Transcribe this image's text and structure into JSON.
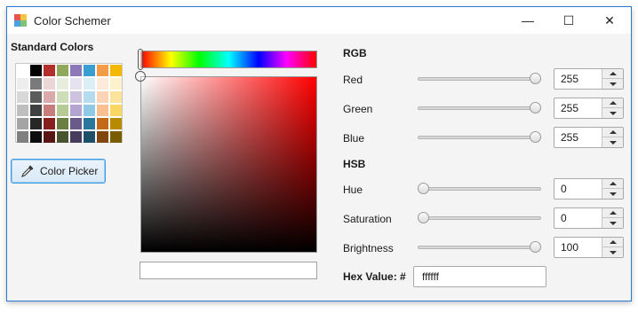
{
  "window": {
    "title": "Color Schemer",
    "controls": {
      "minimize": "—",
      "maximize": "☐",
      "close": "✕"
    }
  },
  "standard_colors": {
    "title": "Standard Colors",
    "rows": [
      [
        "#ffffff",
        "#000000",
        "#b22f2c",
        "#8fa85a",
        "#8e79b8",
        "#3a9ed0",
        "#f39c47",
        "#f5b800"
      ],
      [
        "#ededed",
        "#7a7a7a",
        "#ecd6d5",
        "#e7eddc",
        "#e6e1ef",
        "#dbeef6",
        "#fdeadb",
        "#fdf2cc"
      ],
      [
        "#d8d8d8",
        "#5c5c5c",
        "#d9aaa9",
        "#cfdcb8",
        "#cdc3df",
        "#b5dbee",
        "#fbd4b6",
        "#fbe49a"
      ],
      [
        "#bfbfbf",
        "#404040",
        "#c67d7b",
        "#b6ca94",
        "#b3a5cf",
        "#8fc9e5",
        "#f9bf91",
        "#f9d765"
      ],
      [
        "#a5a5a5",
        "#262626",
        "#85201e",
        "#6b7e43",
        "#6a5a8a",
        "#2b769c",
        "#c26a17",
        "#b88a00"
      ],
      [
        "#7f7f7f",
        "#0d0d0d",
        "#591514",
        "#47542d",
        "#473c5c",
        "#1d4f68",
        "#81470f",
        "#7a5c00"
      ]
    ]
  },
  "color_picker_button": {
    "label": "Color Picker",
    "icon": "eyedropper-icon"
  },
  "hue_bar": {
    "hue": 0
  },
  "sv_area": {
    "saturation": 0,
    "brightness": 100
  },
  "preview": {
    "color": "#ffffff"
  },
  "rgb": {
    "title": "RGB",
    "fields": [
      {
        "label": "Red",
        "value": "255",
        "fraction": 1.0
      },
      {
        "label": "Green",
        "value": "255",
        "fraction": 1.0
      },
      {
        "label": "Blue",
        "value": "255",
        "fraction": 1.0
      }
    ]
  },
  "hsb": {
    "title": "HSB",
    "fields": [
      {
        "label": "Hue",
        "value": "0",
        "fraction": 0.0
      },
      {
        "label": "Saturation",
        "value": "0",
        "fraction": 0.0
      },
      {
        "label": "Brightness",
        "value": "100",
        "fraction": 1.0
      }
    ]
  },
  "hex": {
    "label": "Hex Value: #",
    "value": "ffffff"
  }
}
